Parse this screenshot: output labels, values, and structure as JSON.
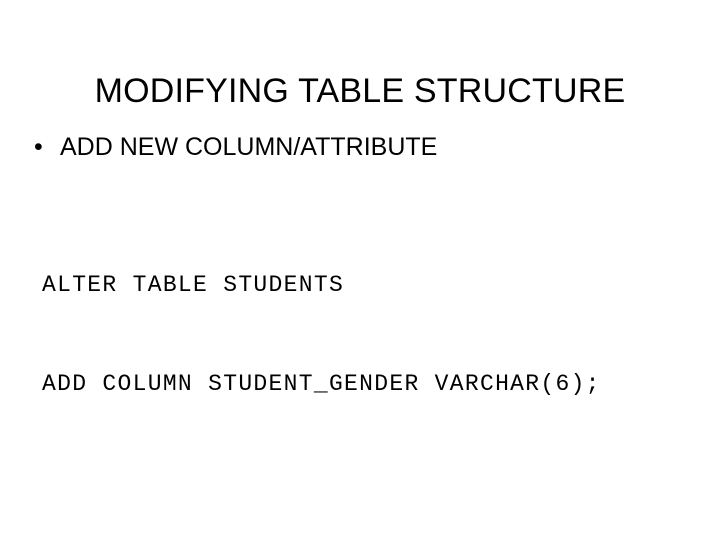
{
  "slide": {
    "title": "MODIFYING TABLE STRUCTURE",
    "background_color": "#ffffff",
    "text_color": "#000000",
    "bullets": [
      {
        "marker": "•",
        "text": "ADD NEW COLUMN/ATTRIBUTE"
      }
    ],
    "code": {
      "lines": [
        "ALTER TABLE STUDENTS",
        "ADD COLUMN STUDENT_GENDER VARCHAR(6);"
      ]
    }
  }
}
